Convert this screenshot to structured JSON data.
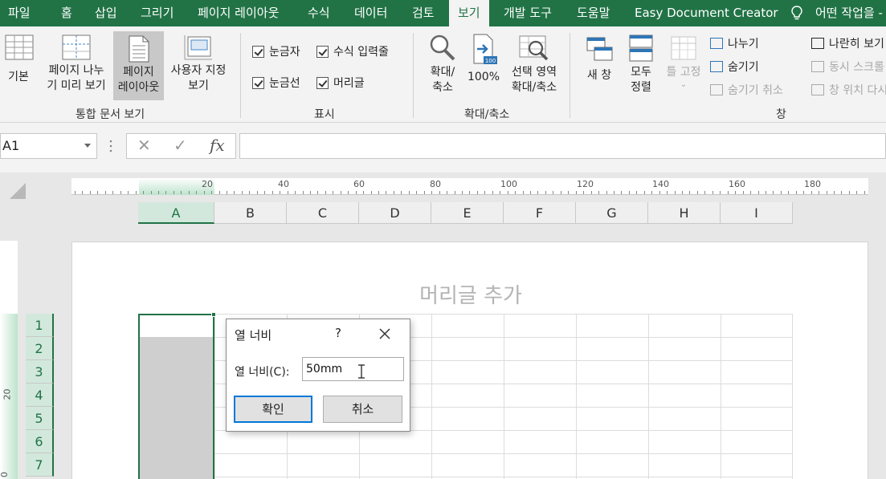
{
  "ribbon_tabs": [
    "파일",
    "홈",
    "삽입",
    "그리기",
    "페이지 레이아웃",
    "수식",
    "데이터",
    "검토",
    "보기",
    "개발 도구",
    "도움말",
    "Easy Document Creator"
  ],
  "active_tab": "보기",
  "tell_me": "어떤 작업을 -",
  "views_group": {
    "normal": "기본",
    "page_break_line1": "페이지 나누",
    "page_break_line2": "기 미리 보기",
    "page_layout_line1": "페이지",
    "page_layout_line2": "레이아웃",
    "custom_line1": "사용자 지정",
    "custom_line2": "보기",
    "label": "통합 문서 보기"
  },
  "show_group": {
    "ruler": "눈금자",
    "formula_bar": "수식 입력줄",
    "gridlines": "눈금선",
    "headings": "머리글",
    "label": "표시"
  },
  "zoom_group": {
    "zoom_line1": "확대/",
    "zoom_line2": "축소",
    "zoom100": "100%",
    "zoom100_badge": "100",
    "zoom_sel_line1": "선택 영역",
    "zoom_sel_line2": "확대/축소",
    "label": "확대/축소"
  },
  "window_group": {
    "new_window": "새 창",
    "arrange_line1": "모두",
    "arrange_line2": "정렬",
    "freeze": "틀 고정",
    "split": "나누기",
    "hide": "숨기기",
    "unhide": "숨기기 취소",
    "side_by_side": "나란히 보기",
    "sync_scroll": "동시 스크롤",
    "reset_pos": "창 위치 다시",
    "label": "창"
  },
  "name_box": "A1",
  "formula_symbols": {
    "cancel": "✕",
    "enter": "✓",
    "fx": "fx"
  },
  "ruler_labels": [
    "20",
    "40",
    "60",
    "80",
    "100",
    "120",
    "140",
    "160",
    "180"
  ],
  "vruler_labels": [
    "20",
    "0"
  ],
  "columns": [
    "A",
    "B",
    "C",
    "D",
    "E",
    "F",
    "G",
    "H",
    "I"
  ],
  "rows": [
    "1",
    "2",
    "3",
    "4",
    "5",
    "6",
    "7"
  ],
  "header_placeholder": "머리글 추가",
  "dialog": {
    "title": "열 너비",
    "help": "?",
    "label": "열 너비(C):",
    "value": "50mm",
    "ok": "확인",
    "cancel": "취소"
  },
  "colors": {
    "accent": "#217346",
    "focus": "#0078d7"
  }
}
